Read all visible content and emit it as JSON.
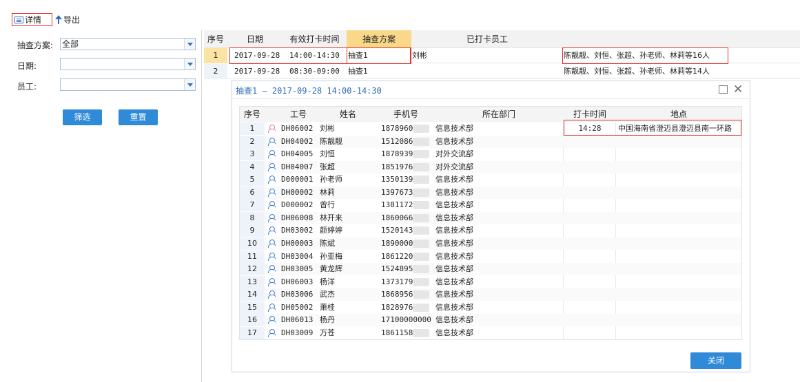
{
  "toolbar": {
    "detail_label": "详情",
    "export_label": "导出"
  },
  "filter": {
    "plan_label": "抽查方案:",
    "plan_value": "全部",
    "date_label": "日期:",
    "date_value": "",
    "staff_label": "员工:",
    "staff_value": "",
    "filter_button": "筛选",
    "reset_button": "重置"
  },
  "grid": {
    "headers": [
      "序号",
      "日期",
      "有效打卡时间",
      "抽查方案",
      "已打卡员工"
    ],
    "rows": [
      {
        "no": "1",
        "date": "2017-09-28",
        "time": "14:00-14:30",
        "plan": "抽查1",
        "staff": "刘彬",
        "summary": "陈靓靓、刘恒、张超、孙老师、林莉等16人"
      },
      {
        "no": "2",
        "date": "2017-09-28",
        "time": "08:30-09:00",
        "plan": "抽查1",
        "staff": "",
        "summary": "陈靓靓、刘恒、张超、孙老师、林莉等14人"
      }
    ]
  },
  "dialog": {
    "title": "抽查1 — 2017-09-28 14:00-14:30",
    "close_label": "关闭",
    "headers": [
      "序号",
      "工号",
      "姓名",
      "手机号",
      "所在部门",
      "打卡时间",
      "地点"
    ],
    "rows": [
      {
        "no": "1",
        "id": "DH06002",
        "name": "刘彬",
        "phone": "18789603",
        "dept": "信息技术部",
        "time": "14:28",
        "place": "中国海南省澄迈县澄迈县南一环路",
        "female": true
      },
      {
        "no": "2",
        "id": "DH04002",
        "name": "陈靓靓",
        "phone": "1512086",
        "dept": "信息技术部",
        "time": "",
        "place": "",
        "female": false
      },
      {
        "no": "3",
        "id": "DH04005",
        "name": "刘恒",
        "phone": "1878939",
        "dept": "对外交流部",
        "time": "",
        "place": "",
        "female": false
      },
      {
        "no": "4",
        "id": "DH04007",
        "name": "张超",
        "phone": "18519765",
        "dept": "对外交流部",
        "time": "",
        "place": "",
        "female": false
      },
      {
        "no": "5",
        "id": "D000001",
        "name": "孙老师",
        "phone": "1350139",
        "dept": "信息技术部",
        "time": "",
        "place": "",
        "female": false
      },
      {
        "no": "6",
        "id": "DH00002",
        "name": "林莉",
        "phone": "1397673",
        "dept": "信息技术部",
        "time": "",
        "place": "",
        "female": false
      },
      {
        "no": "7",
        "id": "D000002",
        "name": "曾行",
        "phone": "1381172",
        "dept": "信息技术部",
        "time": "",
        "place": "",
        "female": false
      },
      {
        "no": "8",
        "id": "DH06008",
        "name": "林开来",
        "phone": "1860066",
        "dept": "信息技术部",
        "time": "",
        "place": "",
        "female": false
      },
      {
        "no": "9",
        "id": "DH03002",
        "name": "颜婷婷",
        "phone": "15201431",
        "dept": "信息技术部",
        "time": "",
        "place": "",
        "female": false
      },
      {
        "no": "10",
        "id": "DH00003",
        "name": "陈斌",
        "phone": "18900001",
        "dept": "信息技术部",
        "time": "",
        "place": "",
        "female": false
      },
      {
        "no": "11",
        "id": "DH03004",
        "name": "孙亚梅",
        "phone": "18612207",
        "dept": "信息技术部",
        "time": "",
        "place": "",
        "female": false
      },
      {
        "no": "12",
        "id": "DH03005",
        "name": "黄龙辉",
        "phone": "15248955",
        "dept": "信息技术部",
        "time": "",
        "place": "",
        "female": false
      },
      {
        "no": "13",
        "id": "DH06003",
        "name": "杨洋",
        "phone": "1373179",
        "dept": "信息技术部",
        "time": "",
        "place": "",
        "female": false
      },
      {
        "no": "14",
        "id": "DH03006",
        "name": "武杰",
        "phone": "1868956",
        "dept": "信息技术部",
        "time": "",
        "place": "",
        "female": false
      },
      {
        "no": "15",
        "id": "DH05002",
        "name": "萧桂",
        "phone": "1828976",
        "dept": "信息技术部",
        "time": "",
        "place": "",
        "female": false
      },
      {
        "no": "16",
        "id": "DH06013",
        "name": "杨丹",
        "phone": "17100000000",
        "dept": "信息技术部",
        "time": "",
        "place": "",
        "female": false
      },
      {
        "no": "17",
        "id": "DH03009",
        "name": "万苍",
        "phone": "1861158",
        "dept": "信息技术部",
        "time": "",
        "place": "",
        "female": false
      }
    ]
  },
  "colors": {
    "accent": "#2f8ad8",
    "highlight": "#e0302a",
    "selected_row": "#fbe3a3",
    "plan_header": "#f9d88a",
    "female_icon": "#e07aa0",
    "male_icon": "#3a7fd0"
  }
}
